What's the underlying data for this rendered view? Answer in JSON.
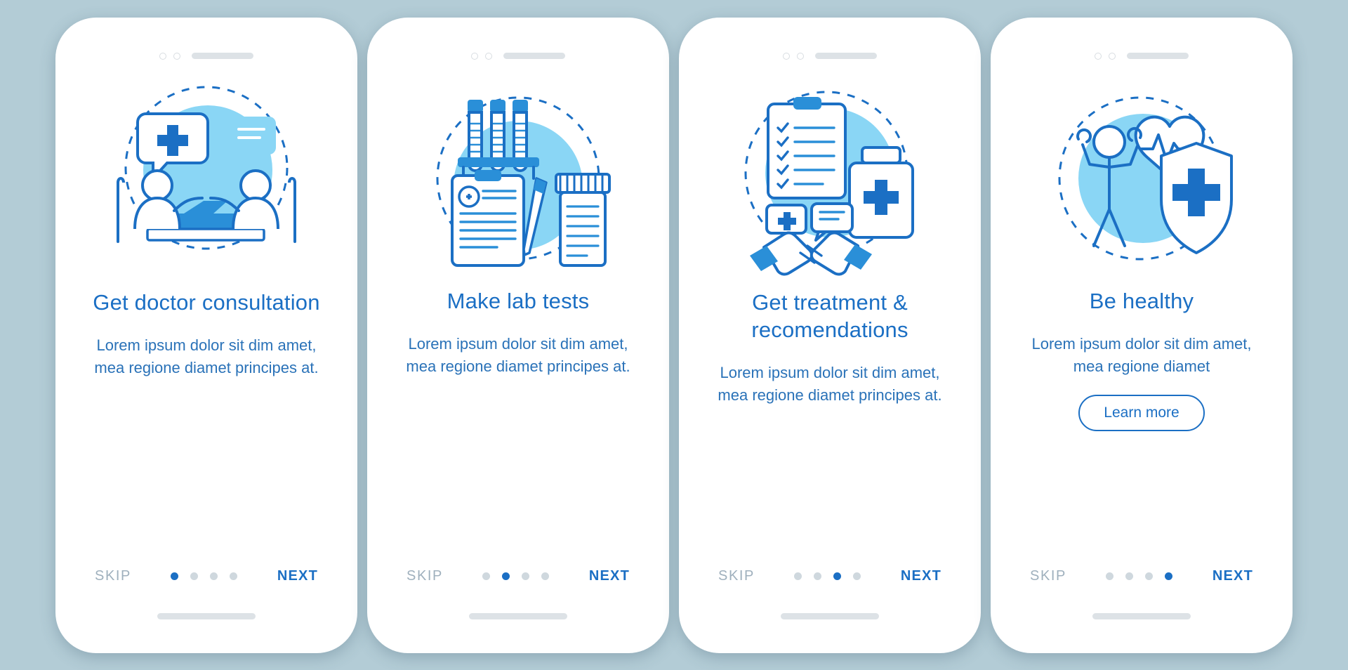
{
  "meta": {
    "background_color": "#b3ccd6",
    "accent_color": "#1b6fc4",
    "light_accent_color": "#7fd4f5",
    "muted_color": "#9fb0bd"
  },
  "common": {
    "skip_label": "SKIP",
    "next_label": "NEXT",
    "dots_count": 4
  },
  "screens": [
    {
      "id": "screen-doctor-consultation",
      "title": "Get doctor consultation",
      "description": "Lorem ipsum dolor sit dim amet, mea regione diamet principes at.",
      "skip_label": "SKIP",
      "next_label": "NEXT",
      "active_dot": 1,
      "illustration": "doctor-consultation-illustration",
      "cta": null
    },
    {
      "id": "screen-lab-tests",
      "title": "Make lab tests",
      "description": "Lorem ipsum dolor sit dim amet, mea regione diamet principes at.",
      "skip_label": "SKIP",
      "next_label": "NEXT",
      "active_dot": 2,
      "illustration": "lab-tests-illustration",
      "cta": null
    },
    {
      "id": "screen-treatment",
      "title": "Get treatment & recomendations",
      "description": "Lorem ipsum dolor sit dim amet, mea regione diamet principes at.",
      "skip_label": "SKIP",
      "next_label": "NEXT",
      "active_dot": 3,
      "illustration": "treatment-illustration",
      "cta": null
    },
    {
      "id": "screen-be-healthy",
      "title": "Be healthy",
      "description": "Lorem ipsum dolor sit dim amet, mea regione diamet",
      "skip_label": "SKIP",
      "next_label": "NEXT",
      "active_dot": 4,
      "illustration": "be-healthy-illustration",
      "cta": "Learn more"
    }
  ]
}
